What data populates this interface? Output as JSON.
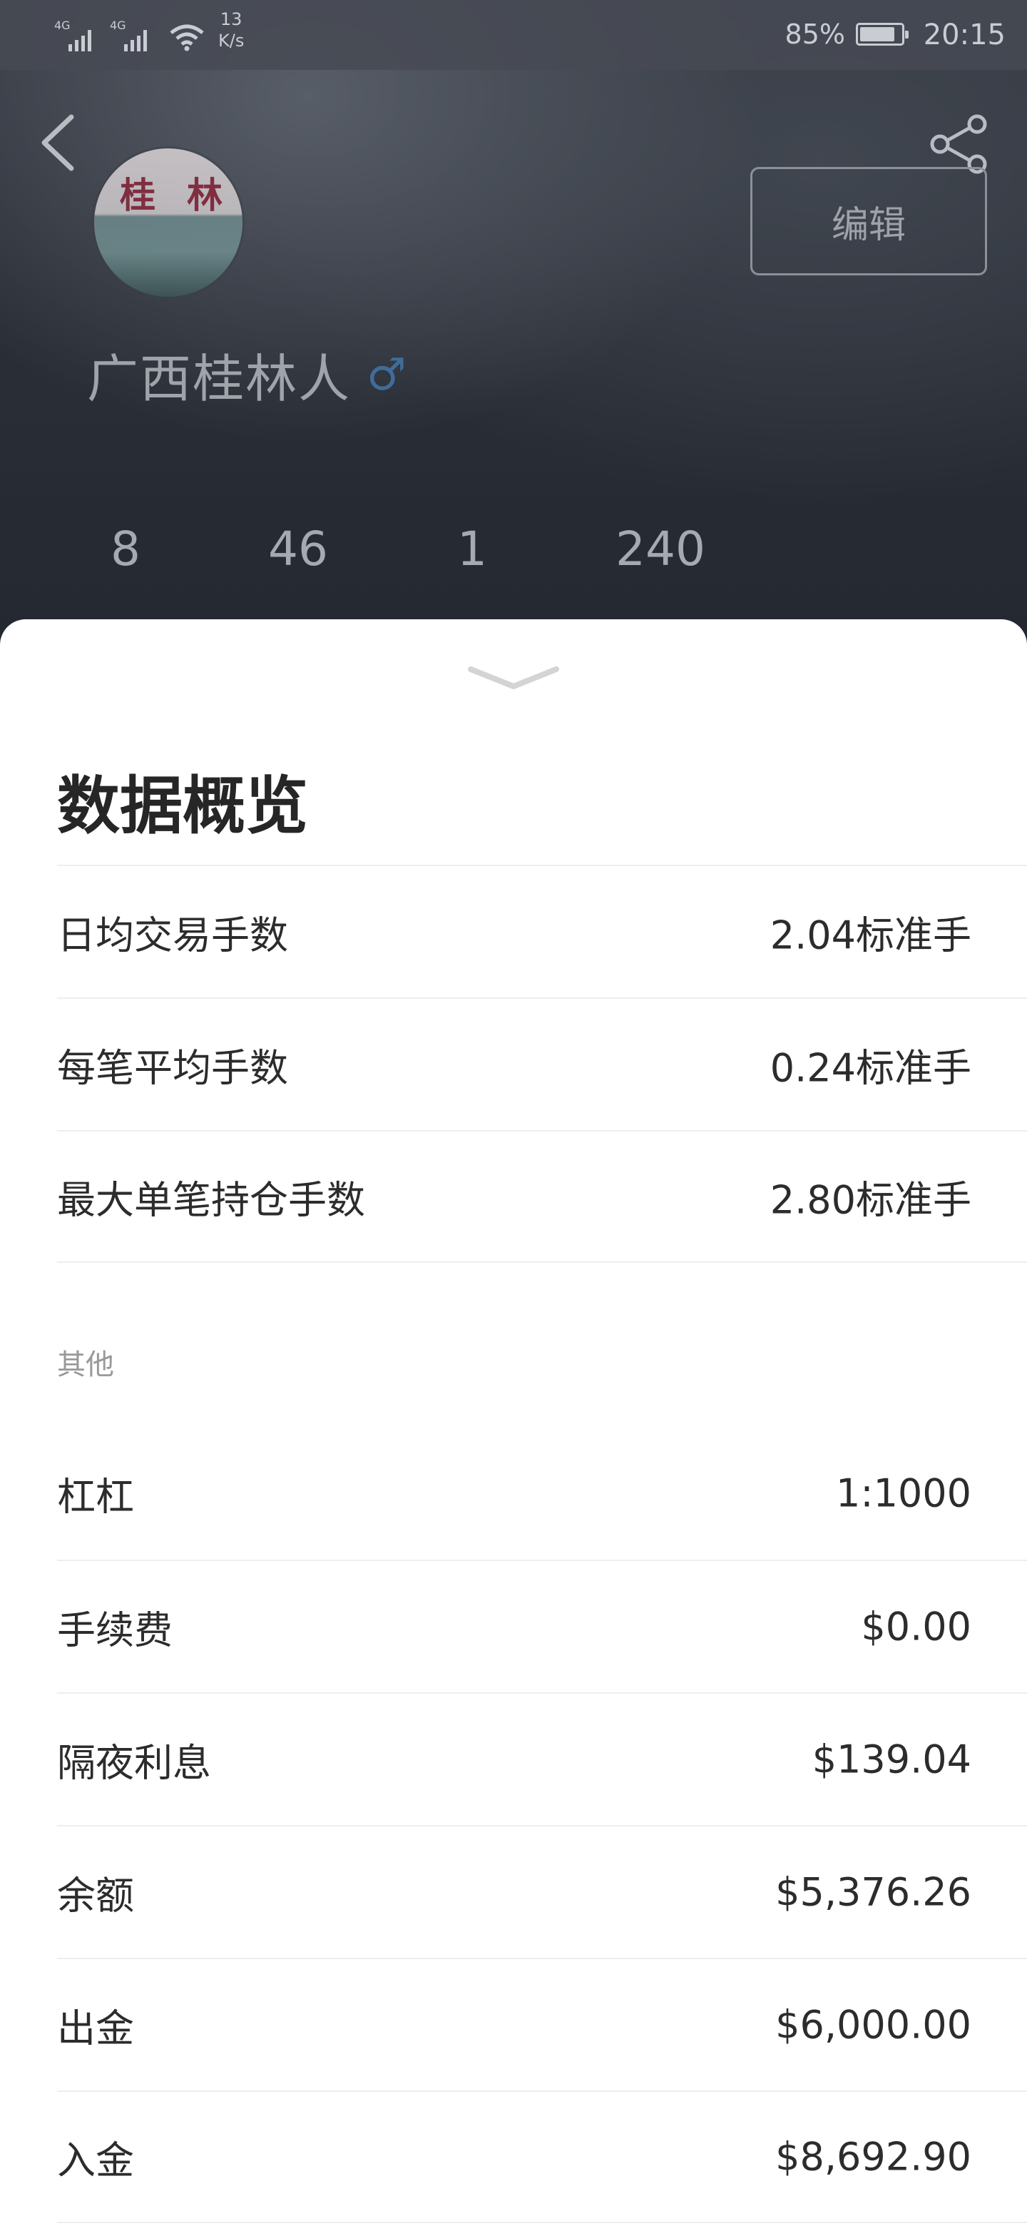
{
  "status_bar": {
    "signal_1_label": "4G",
    "signal_2_label": "4G",
    "net_speed_value": "13",
    "net_speed_unit": "K/s",
    "battery_percent": "85%",
    "time": "20:15"
  },
  "profile": {
    "avatar_text_1": "桂",
    "avatar_text_2": "林",
    "username": "广西桂林人",
    "gender_symbol": "♂",
    "edit_label": "编辑",
    "stats": [
      {
        "value": "8",
        "label": ""
      },
      {
        "value": "46",
        "label": ""
      },
      {
        "value": "1",
        "label": ""
      },
      {
        "value": "240",
        "label": ""
      }
    ]
  },
  "sheet": {
    "title": "数据概览",
    "primary_rows": [
      {
        "label": "日均交易手数",
        "value": "2.04标准手"
      },
      {
        "label": "每笔平均手数",
        "value": "0.24标准手"
      },
      {
        "label": "最大单笔持仓手数",
        "value": "2.80标准手"
      }
    ],
    "other_section_label": "其他",
    "other_rows": [
      {
        "label": "杠杠",
        "value": "1:1000"
      },
      {
        "label": "手续费",
        "value": "$0.00"
      },
      {
        "label": "隔夜利息",
        "value": "$139.04"
      },
      {
        "label": "余额",
        "value": "$5,376.26"
      },
      {
        "label": "出金",
        "value": "$6,000.00"
      },
      {
        "label": "入金",
        "value": "$8,692.90"
      }
    ]
  },
  "colors": {
    "sheet_background": "#ffffff",
    "text_primary": "#2c2c2c",
    "text_muted": "#999999",
    "gender_icon": "#3f6d99"
  }
}
